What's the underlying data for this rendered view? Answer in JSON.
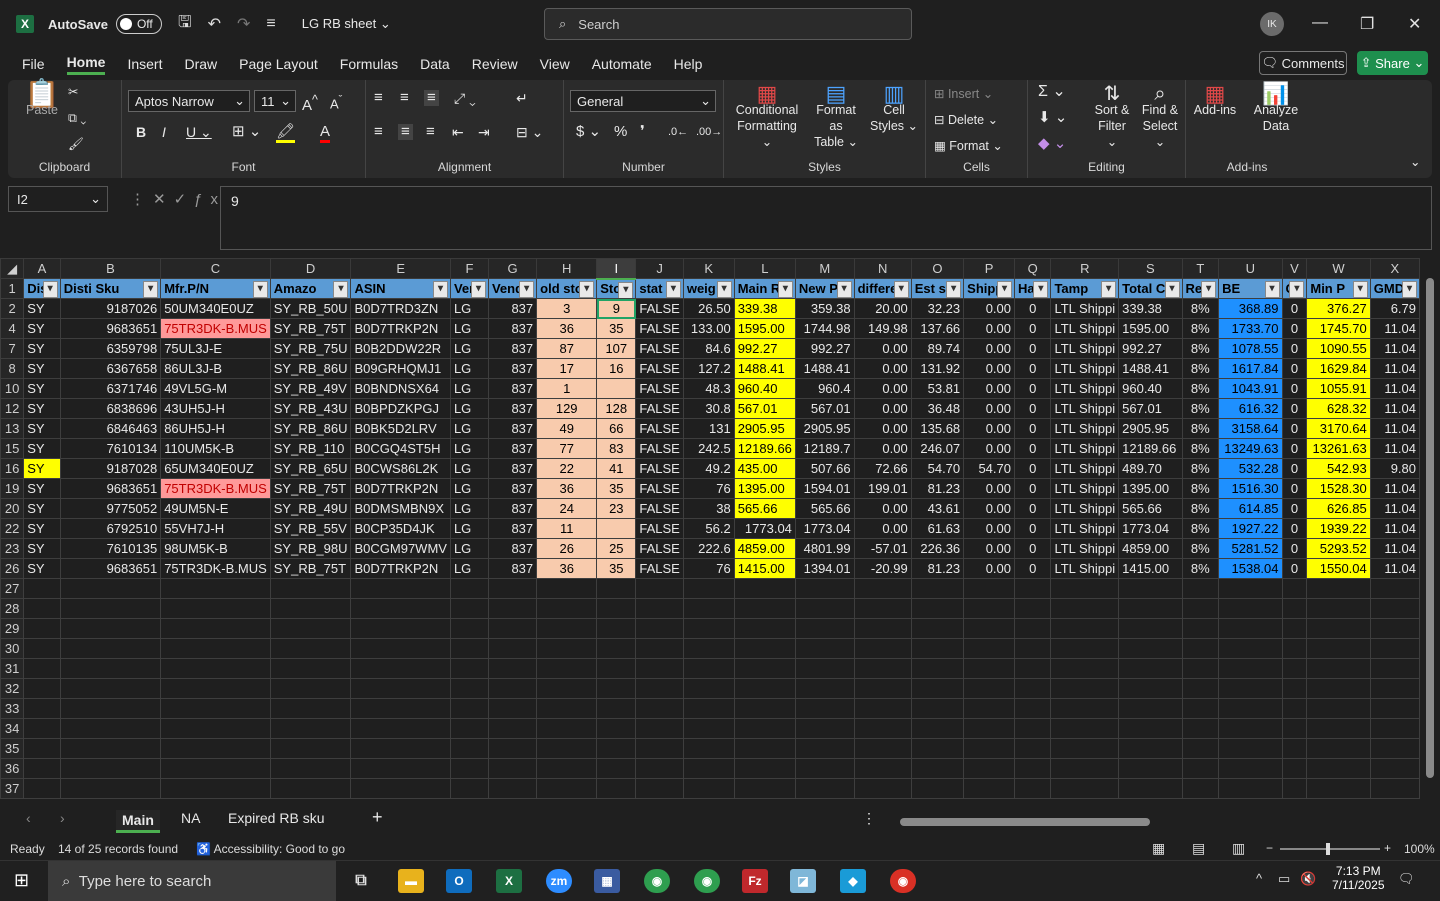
{
  "titlebar": {
    "autosave": "AutoSave",
    "toggle": "Off",
    "doc_name": "LG RB sheet",
    "search_placeholder": "Search",
    "avatar": "IK"
  },
  "menu": [
    "File",
    "Home",
    "Insert",
    "Draw",
    "Page Layout",
    "Formulas",
    "Data",
    "Review",
    "View",
    "Automate",
    "Help"
  ],
  "menu_active": "Home",
  "actions": {
    "comments": "Comments",
    "share": "Share"
  },
  "ribbon": {
    "clipboard": {
      "paste": "Paste",
      "name": "Clipboard"
    },
    "font": {
      "family": "Aptos Narrow",
      "size": "11",
      "name": "Font"
    },
    "alignment": {
      "name": "Alignment"
    },
    "number": {
      "format": "General",
      "name": "Number"
    },
    "styles": {
      "conditional": "Conditional",
      "conditional2": "Formatting",
      "format_as": "Format as",
      "format_as2": "Table",
      "cell": "Cell",
      "cell2": "Styles",
      "name": "Styles"
    },
    "cells": {
      "insert": "Insert",
      "delete": "Delete",
      "format": "Format",
      "name": "Cells"
    },
    "editing": {
      "sort": "Sort &",
      "sort2": "Filter",
      "find": "Find &",
      "find2": "Select",
      "name": "Editing"
    },
    "addins": {
      "addins": "Add-ins",
      "analyze": "Analyze",
      "analyze2": "Data",
      "name": "Add-ins"
    }
  },
  "formula_bar": {
    "name_box": "I2",
    "value": "9"
  },
  "columns": [
    "A",
    "B",
    "C",
    "D",
    "E",
    "F",
    "G",
    "H",
    "I",
    "J",
    "K",
    "L",
    "M",
    "N",
    "O",
    "P",
    "Q",
    "R",
    "S",
    "T",
    "U",
    "V",
    "W",
    "X"
  ],
  "headers": [
    "Dis",
    "Disti Sku",
    "Mfr.P/N",
    "Amazo",
    "ASIN",
    "Ver",
    "Vend",
    "old sto",
    "Sto",
    "stat",
    "weig",
    "Main R",
    "New P",
    "differe",
    "Est sl",
    "Shipp",
    "Ha",
    "Tamp",
    "Total C",
    "Ret",
    "BE",
    "G",
    "Min P",
    "GMD"
  ],
  "rows": [
    {
      "n": "2",
      "c": [
        "SY",
        "9187026",
        "50UM340E0UZ",
        "SY_RB_50U",
        "B0D7TRD3ZN",
        "LG",
        "837",
        "3",
        "9",
        "FALSE",
        "26.50",
        "339.38",
        "359.38",
        "20.00",
        "32.23",
        "0.00",
        "0",
        "LTL Shippi",
        "339.38",
        "8%",
        "368.89",
        "0",
        "376.27",
        "6.79"
      ]
    },
    {
      "n": "4",
      "c": [
        "SY",
        "9683651",
        "75TR3DK-B.MUS",
        "SY_RB_75T",
        "B0D7TRKP2N",
        "LG",
        "837",
        "36",
        "35",
        "FALSE",
        "133.00",
        "1595.00",
        "1744.98",
        "149.98",
        "137.66",
        "0.00",
        "0",
        "LTL Shippi",
        "1595.00",
        "8%",
        "1733.70",
        "0",
        "1745.70",
        "11.04"
      ]
    },
    {
      "n": "7",
      "c": [
        "SY",
        "6359798",
        "75UL3J-E",
        "SY_RB_75U",
        "B0B2DDW22R",
        "LG",
        "837",
        "87",
        "107",
        "FALSE",
        "84.6",
        "992.27",
        "992.27",
        "0.00",
        "89.74",
        "0.00",
        "0",
        "LTL Shippi",
        "992.27",
        "8%",
        "1078.55",
        "0",
        "1090.55",
        "11.04"
      ]
    },
    {
      "n": "8",
      "c": [
        "SY",
        "6367658",
        "86UL3J-B",
        "SY_RB_86U",
        "B09GRHQMJ1",
        "LG",
        "837",
        "17",
        "16",
        "FALSE",
        "127.2",
        "1488.41",
        "1488.41",
        "0.00",
        "131.92",
        "0.00",
        "0",
        "LTL Shippi",
        "1488.41",
        "8%",
        "1617.84",
        "0",
        "1629.84",
        "11.04"
      ]
    },
    {
      "n": "10",
      "c": [
        "SY",
        "6371746",
        "49VL5G-M",
        "SY_RB_49V",
        "B0BNDNSX64",
        "LG",
        "837",
        "1",
        "",
        "FALSE",
        "48.3",
        "960.40",
        "960.4",
        "0.00",
        "53.81",
        "0.00",
        "0",
        "LTL Shippi",
        "960.40",
        "8%",
        "1043.91",
        "0",
        "1055.91",
        "11.04"
      ]
    },
    {
      "n": "12",
      "c": [
        "SY",
        "6838696",
        "43UH5J-H",
        "SY_RB_43U",
        "B0BPDZKPGJ",
        "LG",
        "837",
        "129",
        "128",
        "FALSE",
        "30.8",
        "567.01",
        "567.01",
        "0.00",
        "36.48",
        "0.00",
        "0",
        "LTL Shippi",
        "567.01",
        "8%",
        "616.32",
        "0",
        "628.32",
        "11.04"
      ]
    },
    {
      "n": "13",
      "c": [
        "SY",
        "6846463",
        "86UH5J-H",
        "SY_RB_86U",
        "B0BK5D2LRV",
        "LG",
        "837",
        "49",
        "66",
        "FALSE",
        "131",
        "2905.95",
        "2905.95",
        "0.00",
        "135.68",
        "0.00",
        "0",
        "LTL Shippi",
        "2905.95",
        "8%",
        "3158.64",
        "0",
        "3170.64",
        "11.04"
      ]
    },
    {
      "n": "15",
      "c": [
        "SY",
        "7610134",
        "110UM5K-B",
        "SY_RB_110",
        "B0CGQ4ST5H",
        "LG",
        "837",
        "77",
        "83",
        "FALSE",
        "242.5",
        "12189.66",
        "12189.7",
        "0.00",
        "246.07",
        "0.00",
        "0",
        "LTL Shippi",
        "12189.66",
        "8%",
        "13249.63",
        "0",
        "13261.63",
        "11.04"
      ]
    },
    {
      "n": "16",
      "c": [
        "SY",
        "9187028",
        "65UM340E0UZ",
        "SY_RB_65U",
        "B0CWS86L2K",
        "LG",
        "837",
        "22",
        "41",
        "FALSE",
        "49.2",
        "435.00",
        "507.66",
        "72.66",
        "54.70",
        "54.70",
        "0",
        "LTL Shippi",
        "489.70",
        "8%",
        "532.28",
        "0",
        "542.93",
        "9.80"
      ]
    },
    {
      "n": "19",
      "c": [
        "SY",
        "9683651",
        "75TR3DK-B.MUS",
        "SY_RB_75T",
        "B0D7TRKP2N",
        "LG",
        "837",
        "36",
        "35",
        "FALSE",
        "76",
        "1395.00",
        "1594.01",
        "199.01",
        "81.23",
        "0.00",
        "0",
        "LTL Shippi",
        "1395.00",
        "8%",
        "1516.30",
        "0",
        "1528.30",
        "11.04"
      ]
    },
    {
      "n": "20",
      "c": [
        "SY",
        "9775052",
        "49UM5N-E",
        "SY_RB_49U",
        "B0DMSMBN9X",
        "LG",
        "837",
        "24",
        "23",
        "FALSE",
        "38",
        "565.66",
        "565.66",
        "0.00",
        "43.61",
        "0.00",
        "0",
        "LTL Shippi",
        "565.66",
        "8%",
        "614.85",
        "0",
        "626.85",
        "11.04"
      ]
    },
    {
      "n": "22",
      "c": [
        "SY",
        "6792510",
        "55VH7J-H",
        "SY_RB_55V",
        "B0CP35D4JK",
        "LG",
        "837",
        "11",
        "",
        "FALSE",
        "56.2",
        "1773.04",
        "1773.04",
        "0.00",
        "61.63",
        "0.00",
        "0",
        "LTL Shippi",
        "1773.04",
        "8%",
        "1927.22",
        "0",
        "1939.22",
        "11.04"
      ]
    },
    {
      "n": "23",
      "c": [
        "SY",
        "7610135",
        "98UM5K-B",
        "SY_RB_98U",
        "B0CGM97WMV",
        "LG",
        "837",
        "26",
        "25",
        "FALSE",
        "222.6",
        "4859.00",
        "4801.99",
        "-57.01",
        "226.36",
        "0.00",
        "0",
        "LTL Shippi",
        "4859.00",
        "8%",
        "5281.52",
        "0",
        "5293.52",
        "11.04"
      ]
    },
    {
      "n": "26",
      "c": [
        "SY",
        "9683651",
        "75TR3DK-B.MUS",
        "SY_RB_75T",
        "B0D7TRKP2N",
        "LG",
        "837",
        "36",
        "35",
        "FALSE",
        "76",
        "1415.00",
        "1394.01",
        "-20.99",
        "81.23",
        "0.00",
        "0",
        "LTL Shippi",
        "1415.00",
        "8%",
        "1538.04",
        "0",
        "1550.04",
        "11.04"
      ]
    }
  ],
  "empty_rows": [
    "27",
    "28",
    "29",
    "30",
    "31",
    "32",
    "33",
    "34",
    "35",
    "36",
    "37"
  ],
  "sheets": [
    "Main",
    "NA",
    "Expired RB sku"
  ],
  "status": {
    "ready": "Ready",
    "records": "14 of 25 records found",
    "accessibility": "Accessibility: Good to go",
    "zoom": "100%"
  },
  "taskbar": {
    "search": "Type here to search",
    "time": "7:13 PM",
    "date": "7/11/2025"
  }
}
